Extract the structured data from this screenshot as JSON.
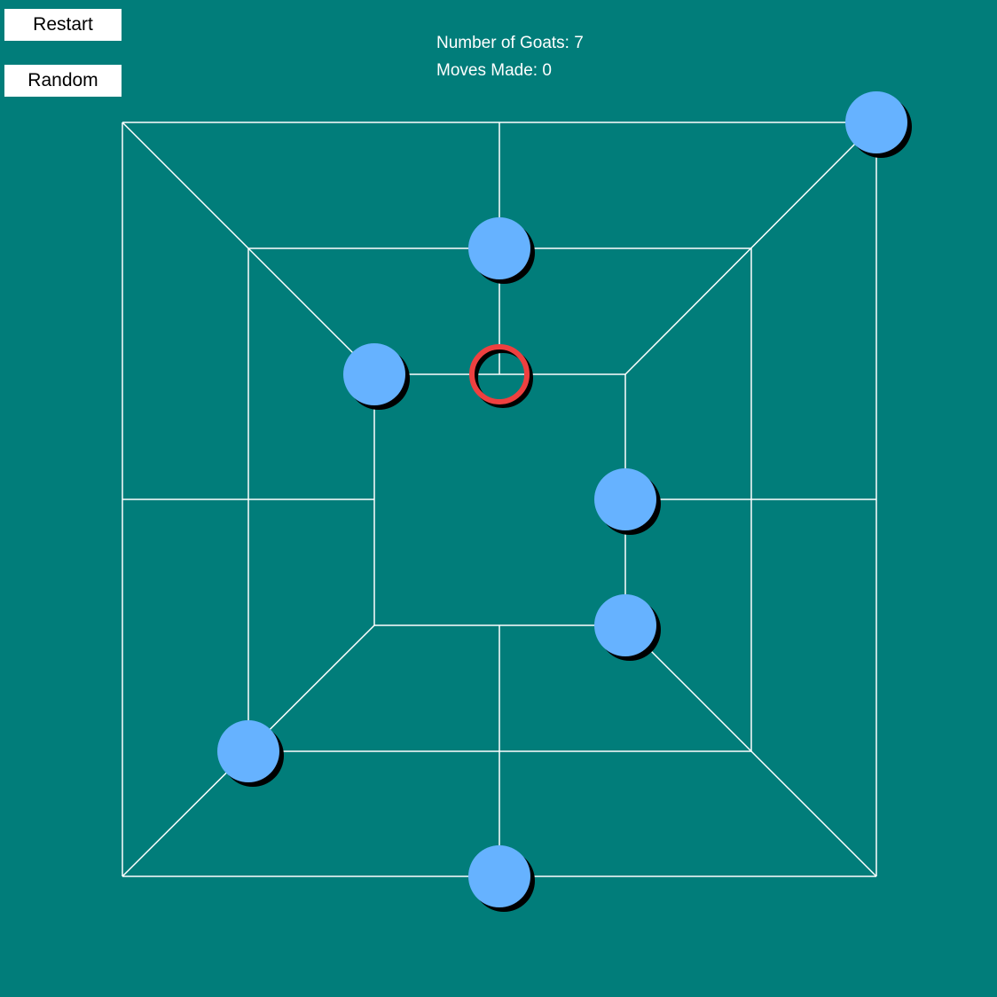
{
  "controls": {
    "restart_label": "Restart",
    "random_label": "Random"
  },
  "status": {
    "goats_text": "Number of Goats: 7",
    "moves_text": "Moves Made: 0"
  },
  "game": {
    "goat_count": 7,
    "moves_made": 0,
    "goats": [
      {
        "point": "outer-top-right"
      },
      {
        "point": "middle-top-center"
      },
      {
        "point": "inner-top-left"
      },
      {
        "point": "inner-right-center"
      },
      {
        "point": "inner-bottom-right"
      },
      {
        "point": "middle-bottom-left"
      },
      {
        "point": "outer-bottom-center"
      }
    ],
    "selected": {
      "point": "inner-top-center"
    }
  },
  "colors": {
    "background": "#017d7a",
    "board_line": "#ffffff",
    "goat": "#66b2ff",
    "goat_shadow": "#000000",
    "selection_ring": "#ee4040"
  }
}
